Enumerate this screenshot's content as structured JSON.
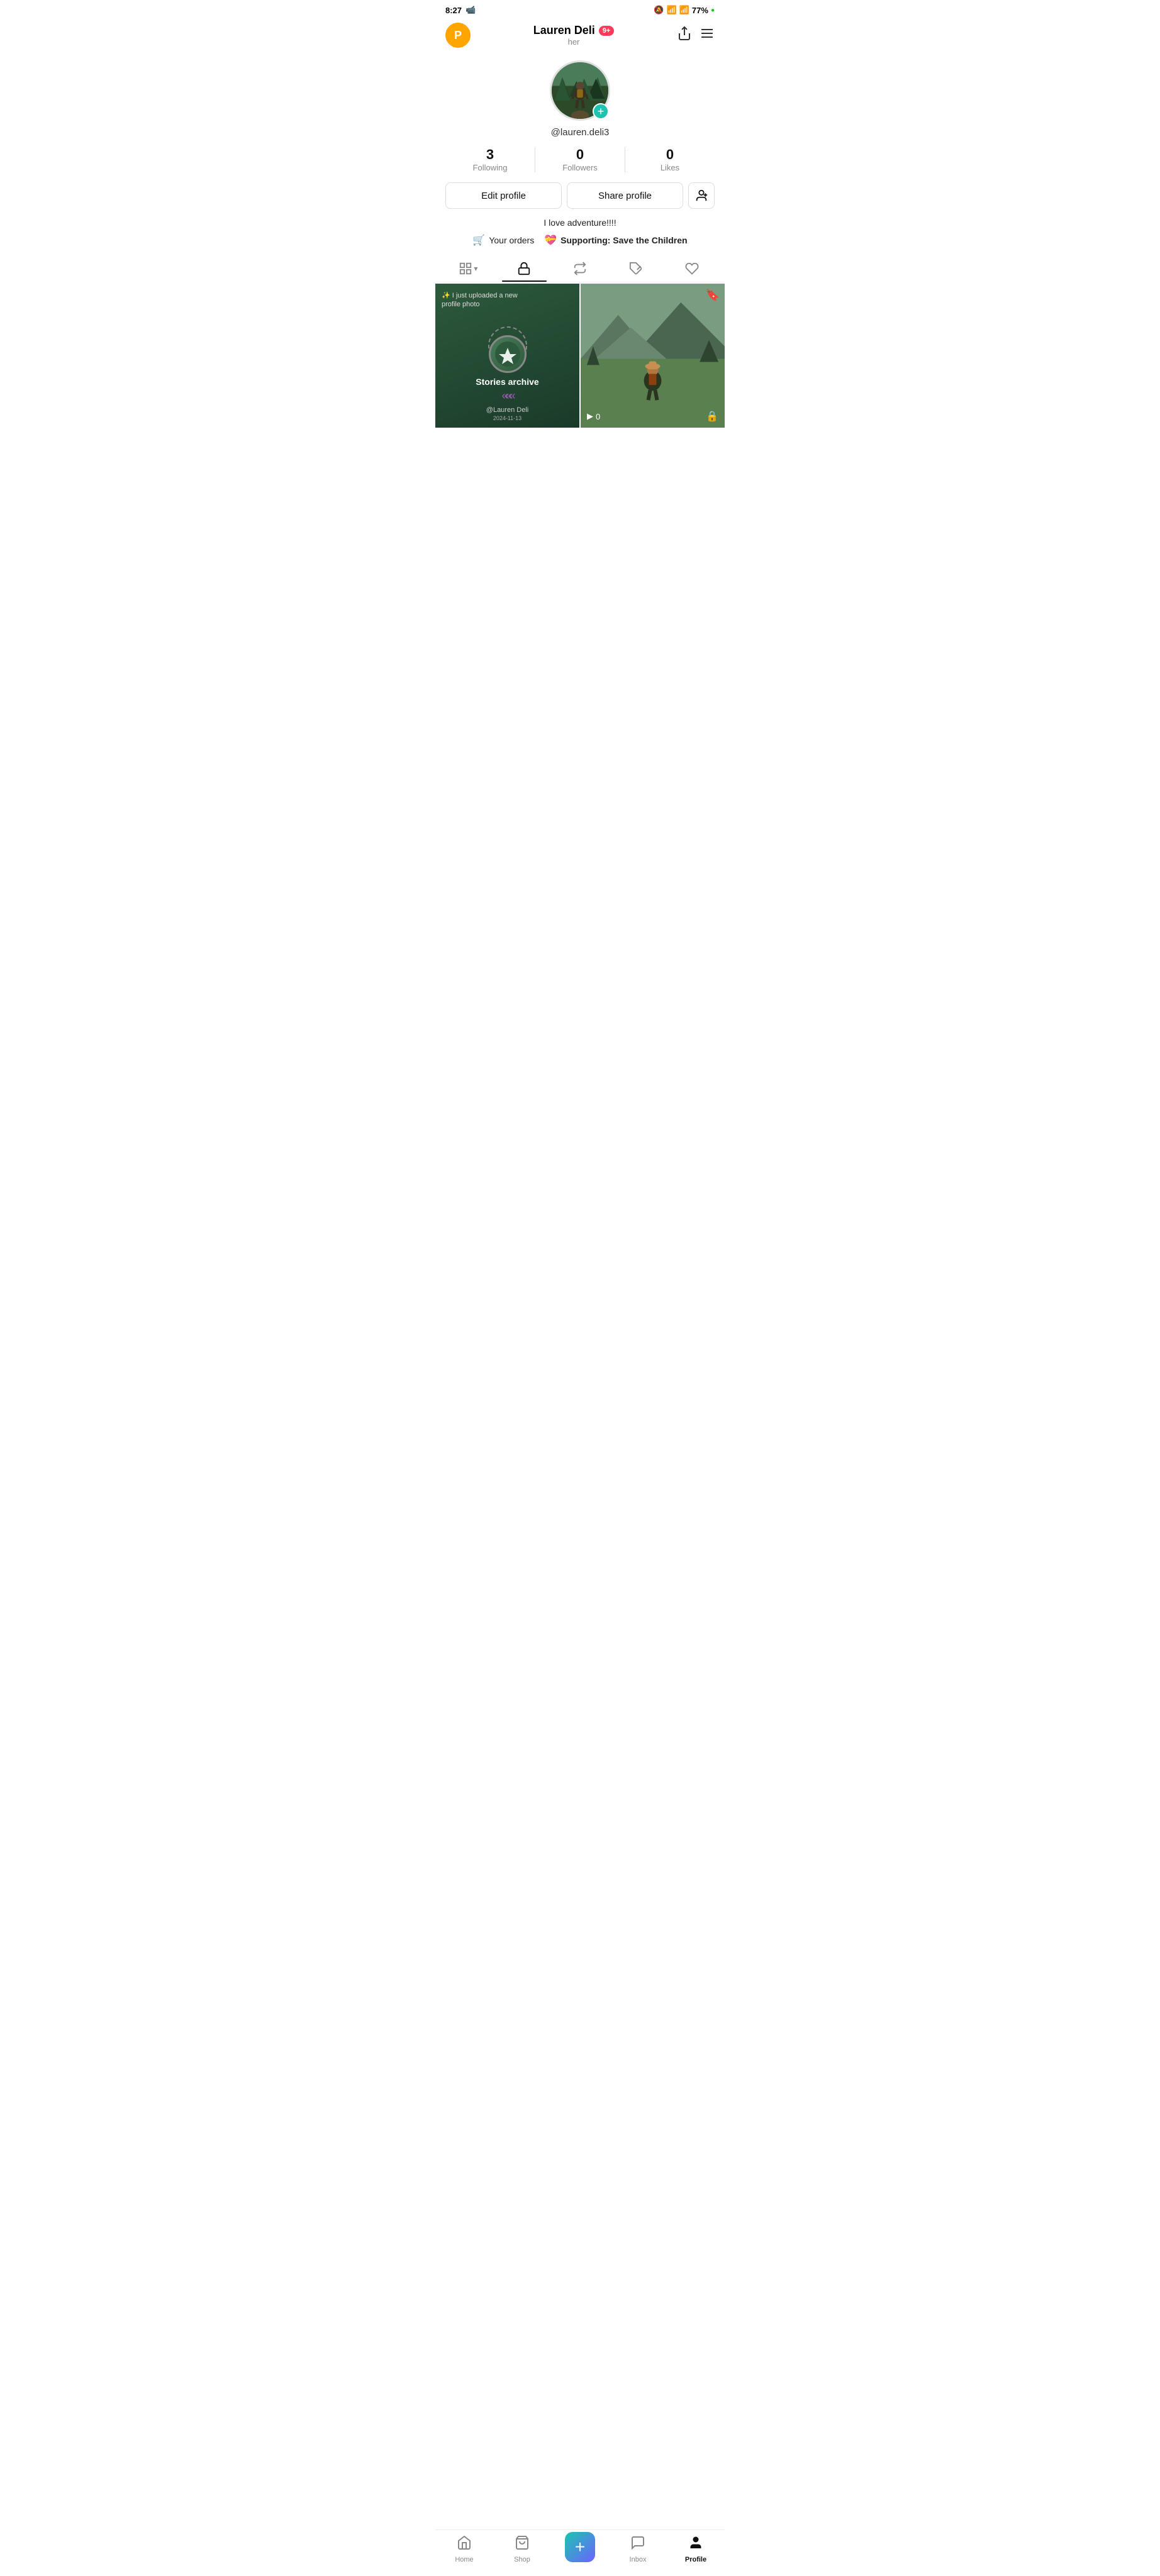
{
  "statusBar": {
    "time": "8:27",
    "battery": "77%",
    "batteryDot": "●"
  },
  "header": {
    "logoLetter": "P",
    "userName": "Lauren Deli",
    "notifBadge": "9+",
    "pronoun": "her"
  },
  "profile": {
    "username": "@lauren.deli3",
    "addButtonLabel": "+",
    "bio": "I love adventure!!!!"
  },
  "stats": [
    {
      "value": "3",
      "label": "Following"
    },
    {
      "value": "0",
      "label": "Followers"
    },
    {
      "value": "0",
      "label": "Likes"
    }
  ],
  "buttons": {
    "editProfile": "Edit profile",
    "shareProfile": "Share profile"
  },
  "links": [
    {
      "icon": "🛒",
      "text": "Your orders"
    },
    {
      "icon": "💝",
      "text": "Supporting: Save the Children",
      "bold": true
    }
  ],
  "storiesCard": {
    "topText": "✨ I just uploaded a new\nprofile photo",
    "label": "Stories archive",
    "username": "@Lauren Deli",
    "date": "2024-11-13"
  },
  "videoCard": {
    "playCount": "0"
  },
  "bottomNav": {
    "items": [
      {
        "label": "Home",
        "icon": "home"
      },
      {
        "label": "Shop",
        "icon": "shop"
      },
      {
        "label": "",
        "icon": "plus"
      },
      {
        "label": "Inbox",
        "icon": "inbox"
      },
      {
        "label": "Profile",
        "icon": "profile",
        "active": true
      }
    ]
  }
}
